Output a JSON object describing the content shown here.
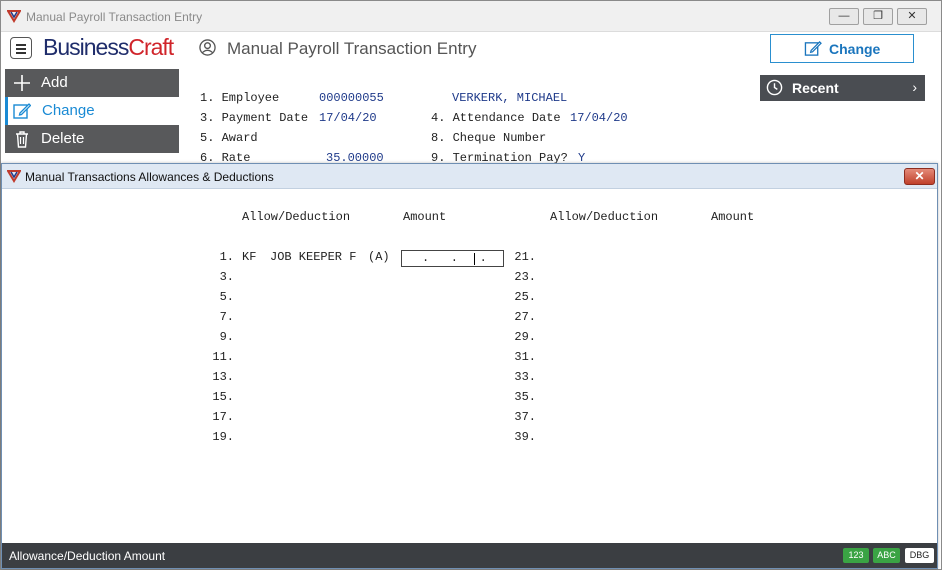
{
  "main_window": {
    "title": "Manual Payroll Transaction Entry",
    "brand_part1": "Business",
    "brand_part2": "Craft",
    "screen_title": "Manual Payroll Transaction Entry",
    "change_button": "Change",
    "minimize": "—",
    "restore": "❐",
    "close": "✕"
  },
  "sidebar": {
    "items": [
      {
        "label": "Add",
        "icon": "plus-icon"
      },
      {
        "label": "Change",
        "icon": "edit-icon"
      },
      {
        "label": "Delete",
        "icon": "trash-icon"
      }
    ]
  },
  "recent": {
    "label": "Recent",
    "chevron": "›"
  },
  "form": {
    "line1_label": "1. Employee",
    "employee_code": "000000055",
    "employee_name": "VERKERK, MICHAEL",
    "line3_label": "3. Payment Date",
    "payment_date": "17/04/20",
    "line4_label": "4. Attendance Date",
    "attendance_date": "17/04/20",
    "line5_label": "5. Award",
    "line8_label": "8. Cheque Number",
    "line6_label": "6. Rate",
    "rate": "35.00000",
    "line9_label": "9. Termination Pay?",
    "termination_pay": "Y"
  },
  "dialog": {
    "title": "Manual Transactions Allowances & Deductions",
    "close": "✕",
    "headers": {
      "left_allow": "Allow/Deduction",
      "left_amount": "Amount",
      "right_allow": "Allow/Deduction",
      "right_amount": "Amount"
    },
    "left_rows": [
      {
        "num": "1.",
        "code": "KF",
        "desc": "JOB KEEPER F",
        "type": "(A)"
      },
      {
        "num": "3."
      },
      {
        "num": "5."
      },
      {
        "num": "7."
      },
      {
        "num": "9."
      },
      {
        "num": "11."
      },
      {
        "num": "13."
      },
      {
        "num": "15."
      },
      {
        "num": "17."
      },
      {
        "num": "19."
      }
    ],
    "right_rows": [
      {
        "num": "21."
      },
      {
        "num": "23."
      },
      {
        "num": "25."
      },
      {
        "num": "27."
      },
      {
        "num": "29."
      },
      {
        "num": "31."
      },
      {
        "num": "33."
      },
      {
        "num": "35."
      },
      {
        "num": "37."
      },
      {
        "num": "39."
      }
    ],
    "amount_value": ".   .   .",
    "status_message": "Allowance/Deduction Amount",
    "badges": [
      {
        "label": "123",
        "color": "#3aa344"
      },
      {
        "label": "ABC",
        "color": "#3aa344"
      },
      {
        "label": "DBG",
        "color": "#ffffff"
      }
    ]
  }
}
